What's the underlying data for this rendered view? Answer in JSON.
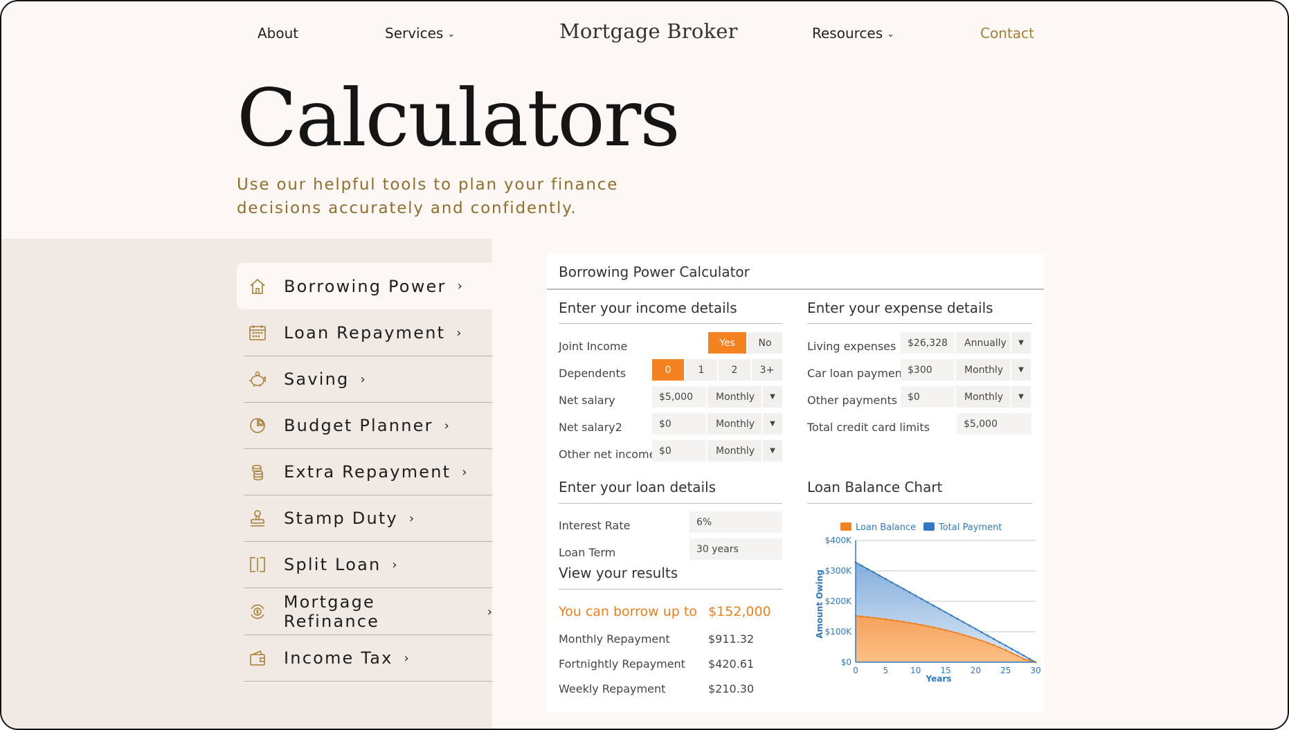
{
  "nav": {
    "about": "About",
    "services": "Services",
    "brand": "Mortgage Broker",
    "resources": "Resources",
    "contact": "Contact"
  },
  "hero": {
    "title": "Calculators",
    "subtitle": "Use our helpful tools to plan your finance decisions accurately and confidently."
  },
  "sidebar": {
    "items": [
      {
        "label": "Borrowing Power",
        "icon": "house-icon"
      },
      {
        "label": "Loan Repayment",
        "icon": "calendar-icon"
      },
      {
        "label": "Saving",
        "icon": "piggy-bank-icon"
      },
      {
        "label": "Budget Planner",
        "icon": "pie-chart-icon"
      },
      {
        "label": "Extra Repayment",
        "icon": "coins-icon"
      },
      {
        "label": "Stamp Duty",
        "icon": "stamp-icon"
      },
      {
        "label": "Split Loan",
        "icon": "split-icon"
      },
      {
        "label": "Mortgage Refinance",
        "icon": "refinance-icon"
      },
      {
        "label": "Income Tax",
        "icon": "wallet-icon"
      }
    ]
  },
  "calculator": {
    "title": "Borrowing Power Calculator",
    "income": {
      "title": "Enter your income details",
      "joint_label": "Joint Income",
      "joint_options": [
        "Yes",
        "No"
      ],
      "dependents_label": "Dependents",
      "dependents_options": [
        "0",
        "1",
        "2",
        "3+"
      ],
      "net_salary_label": "Net salary",
      "net_salary_value": "$5,000",
      "net_salary_freq": "Monthly",
      "net_salary2_label": "Net salary2",
      "net_salary2_value": "$0",
      "net_salary2_freq": "Monthly",
      "other_label": "Other net income",
      "other_value": "$0",
      "other_freq": "Monthly"
    },
    "expense": {
      "title": "Enter your expense details",
      "living_label": "Living expenses",
      "living_value": "$26,328",
      "living_freq": "Annually",
      "car_label": "Car loan payment",
      "car_value": "$300",
      "car_freq": "Monthly",
      "other_label": "Other payments",
      "other_value": "$0",
      "other_freq": "Monthly",
      "cc_label": "Total credit card limits",
      "cc_value": "$5,000"
    },
    "loan": {
      "title": "Enter your loan details",
      "rate_label": "Interest Rate",
      "rate_value": "6%",
      "term_label": "Loan Term",
      "term_value": "30 years"
    },
    "results": {
      "title": "View your results",
      "borrow_label": "You can borrow up to",
      "borrow_value": "$152,000",
      "monthly_label": "Monthly Repayment",
      "monthly_value": "$911.32",
      "fortnightly_label": "Fortnightly Repayment",
      "fortnightly_value": "$420.61",
      "weekly_label": "Weekly Repayment",
      "weekly_value": "$210.30"
    },
    "chart_title": "Loan Balance Chart"
  },
  "colors": {
    "accent": "#f58220",
    "gold": "#a57f34",
    "blue": "#2f78c4"
  },
  "chart_data": {
    "type": "area",
    "title": "Loan Balance Chart",
    "xlabel": "Years",
    "ylabel": "Amount Owing",
    "x": [
      0,
      1,
      2,
      3,
      4,
      5,
      6,
      7,
      8,
      9,
      10,
      11,
      12,
      13,
      14,
      15,
      16,
      17,
      18,
      19,
      20,
      21,
      22,
      23,
      24,
      25,
      26,
      27,
      28,
      29,
      30
    ],
    "xticks": [
      "0",
      "5",
      "10",
      "15",
      "20",
      "25",
      "30"
    ],
    "yticks": [
      "$0",
      "$100K",
      "$200K",
      "$300K",
      "$400K"
    ],
    "ylim": [
      0,
      400000
    ],
    "xlim": [
      0,
      30
    ],
    "legend": "top",
    "series": [
      {
        "name": "Loan Balance",
        "color": "#f58220",
        "values": [
          152000,
          150100,
          148000,
          145800,
          143500,
          141000,
          138300,
          135500,
          132500,
          129300,
          125900,
          122300,
          118400,
          114300,
          109900,
          105300,
          100300,
          95100,
          89500,
          83600,
          77300,
          70700,
          63600,
          56100,
          48100,
          39600,
          30600,
          21100,
          10900,
          5000,
          0
        ]
      },
      {
        "name": "Total Payment",
        "color": "#2f78c4",
        "values": [
          328000,
          317100,
          306100,
          295200,
          284300,
          273400,
          262400,
          251500,
          240600,
          229600,
          218700,
          207800,
          196800,
          185900,
          175000,
          164000,
          153100,
          142200,
          131200,
          120300,
          109400,
          98400,
          87500,
          76600,
          65600,
          54700,
          43800,
          32800,
          21900,
          10900,
          0
        ]
      }
    ]
  }
}
